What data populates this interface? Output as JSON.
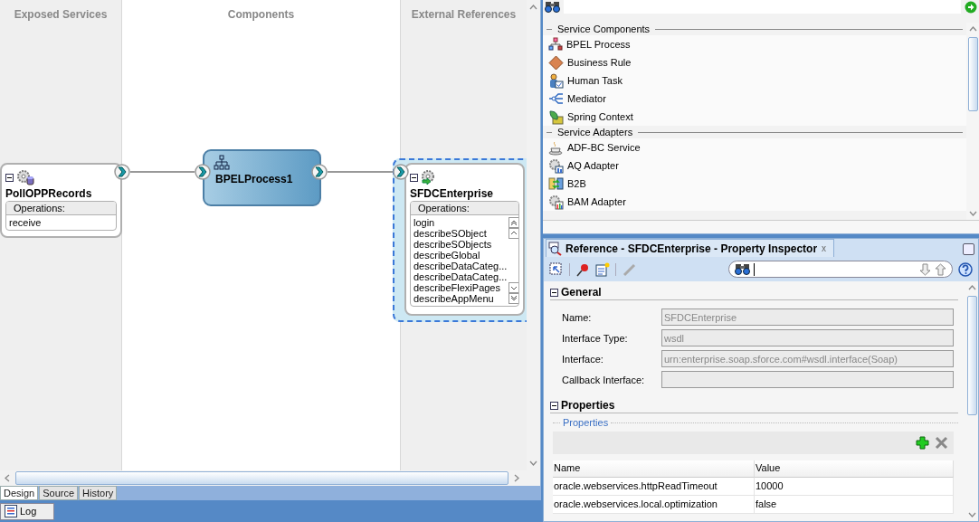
{
  "canvas": {
    "lanes": [
      {
        "title": "Exposed Services"
      },
      {
        "title": "Components"
      },
      {
        "title": "External References"
      }
    ],
    "services": [
      {
        "name": "PollOPPRecords",
        "expanded": true,
        "operations_label": "Operations:",
        "operations": [
          "receive"
        ]
      }
    ],
    "components": [
      {
        "name": "BPELProcess1"
      }
    ],
    "references": [
      {
        "name": "SFDCEnterprise",
        "expanded": true,
        "selected": true,
        "operations_label": "Operations:",
        "operations": [
          "login",
          "describeSObject",
          "describeSObjects",
          "describeGlobal",
          "describeDataCateg...",
          "describeDataCateg...",
          "describeFlexiPages",
          "describeAppMenu"
        ]
      }
    ]
  },
  "editor_tabs": [
    {
      "label": "Design",
      "selected": true
    },
    {
      "label": "Source",
      "selected": false
    },
    {
      "label": "History",
      "selected": false
    }
  ],
  "log_tab": {
    "label": "Log"
  },
  "palette": {
    "sections": [
      {
        "title": "Service Components",
        "items": [
          {
            "label": "BPEL Process"
          },
          {
            "label": "Business Rule"
          },
          {
            "label": "Human Task"
          },
          {
            "label": "Mediator"
          },
          {
            "label": "Spring Context"
          }
        ]
      },
      {
        "title": "Service Adapters",
        "items": [
          {
            "label": "ADF-BC Service"
          },
          {
            "label": "AQ Adapter"
          },
          {
            "label": "B2B"
          },
          {
            "label": "BAM Adapter"
          }
        ]
      }
    ]
  },
  "inspector": {
    "title": "Reference - SFDCEnterprise - Property Inspector",
    "close": "x",
    "sections": [
      {
        "kind": "form",
        "title": "General",
        "expanded": true,
        "fields": [
          {
            "label": "Name:",
            "value": "SFDCEnterprise"
          },
          {
            "label": "Interface Type:",
            "value": "wsdl"
          },
          {
            "label": "Interface:",
            "value": "urn:enterprise.soap.sforce.com#wsdl.interface(Soap)"
          },
          {
            "label": "Callback Interface:"
          }
        ]
      },
      {
        "kind": "table",
        "title": "Properties",
        "expanded": true,
        "group_title": "Properties",
        "columns": [
          "Name",
          "Value"
        ],
        "rows": [
          [
            "oracle.webservices.httpReadTimeout",
            "10000"
          ],
          [
            "oracle.webservices.local.optimization",
            "false"
          ]
        ]
      }
    ]
  }
}
